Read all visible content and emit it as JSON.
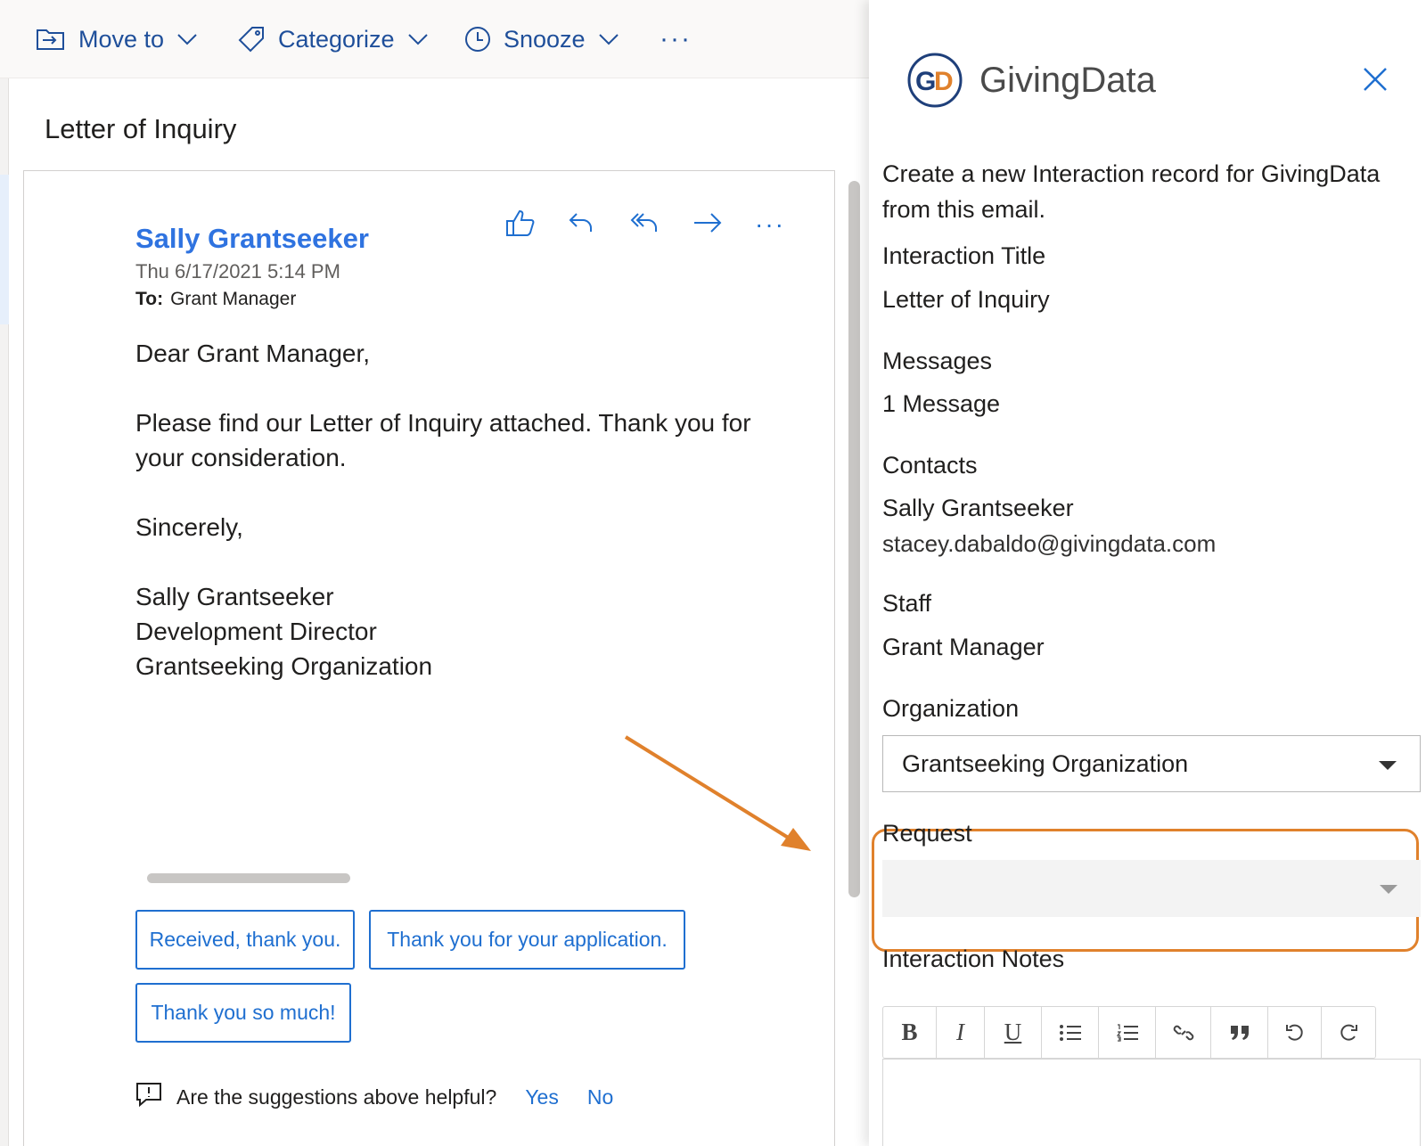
{
  "toolbar": {
    "move_to": "Move to",
    "categorize": "Categorize",
    "snooze": "Snooze",
    "more": "···"
  },
  "email": {
    "subject": "Letter of Inquiry",
    "sender": "Sally Grantseeker",
    "date": "Thu 6/17/2021 5:14 PM",
    "to_label": "To:",
    "to_value": "Grant Manager",
    "more_actions": "···",
    "body": {
      "greeting": "Dear Grant Manager,",
      "paragraph": "Please find our Letter of Inquiry attached. Thank you for your consideration.",
      "closing": "Sincerely,",
      "signature_name": "Sally Grantseeker",
      "signature_title": "Development Director",
      "signature_org": "Grantseeking Organization"
    },
    "suggested_replies": [
      "Received, thank you.",
      "Thank you for your application.",
      "Thank you so much!"
    ],
    "feedback": {
      "question": "Are the suggestions above helpful?",
      "yes": "Yes",
      "no": "No"
    }
  },
  "addin": {
    "logo_monogram_g": "G",
    "logo_monogram_d": "D",
    "brand": "GivingData",
    "intro": "Create a new Interaction record for GivingData from this email.",
    "fields": {
      "title_label": "Interaction Title",
      "title_value": "Letter of Inquiry",
      "messages_label": "Messages",
      "messages_value": "1 Message",
      "contacts_label": "Contacts",
      "contact_name": "Sally Grantseeker",
      "contact_email": "stacey.dabaldo@givingdata.com",
      "staff_label": "Staff",
      "staff_value": "Grant Manager",
      "organization_label": "Organization",
      "organization_value": "Grantseeking Organization",
      "request_label": "Request",
      "request_value": "",
      "notes_label": "Interaction Notes"
    },
    "editor_buttons": [
      "B",
      "I",
      "U",
      "bulleted-list",
      "numbered-list",
      "link",
      "quote",
      "undo",
      "redo"
    ]
  },
  "colors": {
    "outlook_blue": "#1f6fd0",
    "sender_blue": "#2f73e0",
    "annotation_orange": "#e0812c",
    "logo_navy": "#1e3f7a",
    "logo_orange": "#e0812c"
  }
}
